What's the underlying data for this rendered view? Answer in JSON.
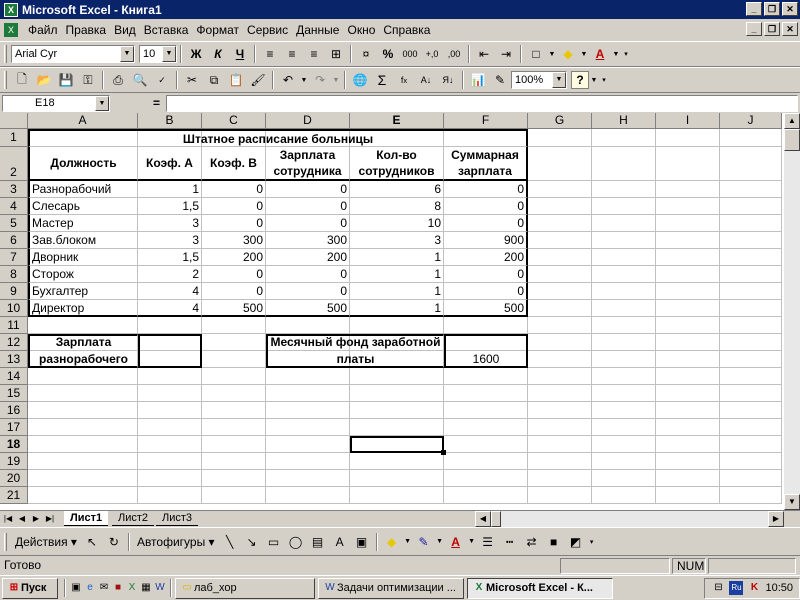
{
  "window": {
    "title": "Microsoft Excel - Книга1"
  },
  "menu": [
    "Файл",
    "Правка",
    "Вид",
    "Вставка",
    "Формат",
    "Сервис",
    "Данные",
    "Окно",
    "Справка"
  ],
  "format_toolbar": {
    "font": "Arial Cyr",
    "size": "10",
    "bold": "Ж",
    "italic": "К",
    "underline": "Ч",
    "percent": "%",
    "thousands": "000"
  },
  "standard_toolbar": {
    "zoom": "100%",
    "help": "?",
    "sum": "Σ"
  },
  "formula_bar": {
    "name_box": "E18",
    "equals": "="
  },
  "columns": [
    "A",
    "B",
    "C",
    "D",
    "E",
    "F",
    "G",
    "H",
    "I",
    "J"
  ],
  "rows": [
    "1",
    "2",
    "3",
    "4",
    "5",
    "6",
    "7",
    "8",
    "9",
    "10",
    "11",
    "12",
    "13",
    "14",
    "15",
    "16",
    "17",
    "18",
    "19",
    "20",
    "21"
  ],
  "selected_cell": {
    "col": "E",
    "row": "18"
  },
  "sheet": {
    "title": "Штатное расписание больницы",
    "headers": [
      "Должность",
      "Коэф. А",
      "Коэф. В",
      "Зарплата сотрудника",
      "Кол-во сотрудников",
      "Суммарная зарплата"
    ],
    "data": [
      [
        "Разнорабочий",
        "1",
        "0",
        "0",
        "6",
        "0"
      ],
      [
        "Слесарь",
        "1,5",
        "0",
        "0",
        "8",
        "0"
      ],
      [
        "Мастер",
        "3",
        "0",
        "0",
        "10",
        "0"
      ],
      [
        "Зав.блоком",
        "3",
        "300",
        "300",
        "3",
        "900"
      ],
      [
        "Дворник",
        "1,5",
        "200",
        "200",
        "1",
        "200"
      ],
      [
        "Сторож",
        "2",
        "0",
        "0",
        "1",
        "0"
      ],
      [
        "Бухгалтер",
        "4",
        "0",
        "0",
        "1",
        "0"
      ],
      [
        "Директор",
        "4",
        "500",
        "500",
        "1",
        "500"
      ]
    ],
    "wage_label": "Зарплата разнорабочего",
    "fund_label": "Месячный фонд заработной платы",
    "fund_value": "1600"
  },
  "sheet_tabs": [
    "Лист1",
    "Лист2",
    "Лист3"
  ],
  "draw_toolbar": {
    "actions": "Действия",
    "autoshapes": "Автофигуры"
  },
  "status": {
    "text": "Готово",
    "num": "NUM"
  },
  "taskbar": {
    "start": "Пуск",
    "buttons": [
      "лаб_хор",
      "Задачи оптимизации ...",
      "Microsoft Excel - К..."
    ],
    "clock": "10:50"
  }
}
